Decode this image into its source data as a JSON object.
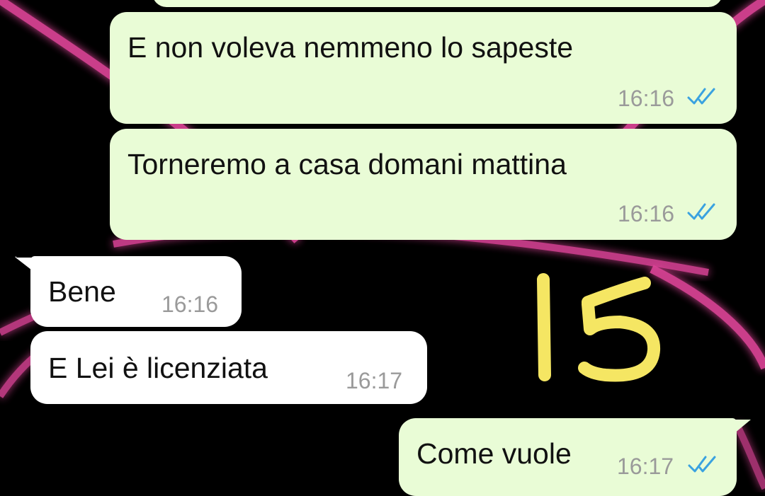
{
  "chat": {
    "messages": [
      {
        "direction": "outgoing",
        "text": "",
        "time": "",
        "read_ticks": false
      },
      {
        "direction": "outgoing",
        "text": "E non voleva nemmeno lo sapeste",
        "time": "16:16",
        "read_ticks": true
      },
      {
        "direction": "outgoing",
        "text": "Torneremo a casa domani mattina",
        "time": "16:16",
        "read_ticks": true
      },
      {
        "direction": "incoming",
        "text": "Bene",
        "time": "16:16",
        "read_ticks": false
      },
      {
        "direction": "incoming",
        "text": "E Lei è licenziata",
        "time": "16:17",
        "read_ticks": false
      },
      {
        "direction": "outgoing",
        "text": "Come vuole",
        "time": "16:17",
        "read_ticks": true
      }
    ]
  },
  "overlay": {
    "handwritten_number": "15",
    "color": "#f5e663"
  },
  "colors": {
    "background": "#000000",
    "neon_ring": "#e0449a",
    "outgoing_bubble": "#e9fcd6",
    "incoming_bubble": "#ffffff",
    "read_tick": "#3aa2e0"
  },
  "icons": [
    "double-check-icon"
  ]
}
